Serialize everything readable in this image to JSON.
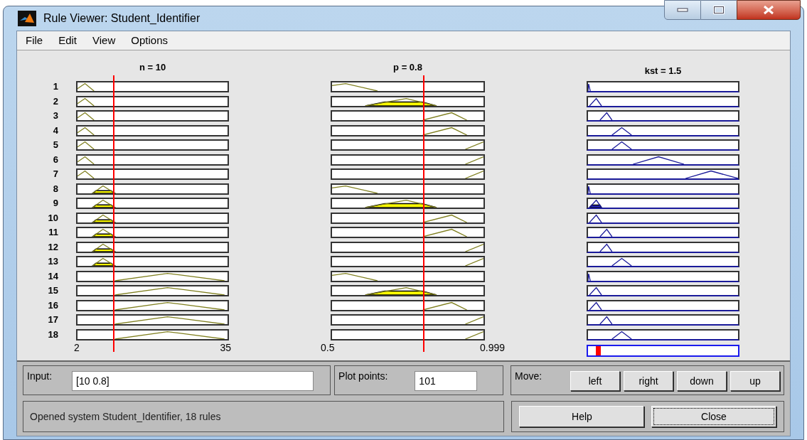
{
  "window": {
    "title": "Rule Viewer: Student_Identifier"
  },
  "menu": [
    "File",
    "Edit",
    "View",
    "Options"
  ],
  "inputs": [
    {
      "label": "n = 10",
      "tick_min": "2",
      "tick_max": "35",
      "level": 0.24
    },
    {
      "label": "p = 0.8",
      "tick_min": "0.5",
      "tick_max": "0.999",
      "level": 0.6
    }
  ],
  "output": {
    "label": "kst = 1.5",
    "level": 0.05
  },
  "rules": [
    {
      "number": "1",
      "cells": [
        {
          "kind": "small",
          "fired": false
        },
        {
          "kind": "low",
          "fired": false
        },
        {
          "kind": "zero",
          "fired": false
        }
      ]
    },
    {
      "number": "2",
      "cells": [
        {
          "kind": "small",
          "fired": false
        },
        {
          "kind": "mid",
          "fired": true
        },
        {
          "kind": "tiny",
          "fired": false
        }
      ]
    },
    {
      "number": "3",
      "cells": [
        {
          "kind": "small",
          "fired": false
        },
        {
          "kind": "high",
          "fired": false
        },
        {
          "kind": "small",
          "fired": false
        }
      ]
    },
    {
      "number": "4",
      "cells": [
        {
          "kind": "small",
          "fired": false
        },
        {
          "kind": "high",
          "fired": false
        },
        {
          "kind": "medium",
          "fired": false
        }
      ]
    },
    {
      "number": "5",
      "cells": [
        {
          "kind": "small",
          "fired": false
        },
        {
          "kind": "top",
          "fired": false
        },
        {
          "kind": "medium",
          "fired": false
        }
      ]
    },
    {
      "number": "6",
      "cells": [
        {
          "kind": "small",
          "fired": false
        },
        {
          "kind": "top",
          "fired": false
        },
        {
          "kind": "large",
          "fired": false
        }
      ]
    },
    {
      "number": "7",
      "cells": [
        {
          "kind": "small",
          "fired": false
        },
        {
          "kind": "top",
          "fired": false
        },
        {
          "kind": "huge",
          "fired": false
        }
      ]
    },
    {
      "number": "8",
      "cells": [
        {
          "kind": "medium",
          "fired": true
        },
        {
          "kind": "low",
          "fired": false
        },
        {
          "kind": "zero",
          "fired": false
        }
      ]
    },
    {
      "number": "9",
      "cells": [
        {
          "kind": "medium",
          "fired": true
        },
        {
          "kind": "mid",
          "fired": true
        },
        {
          "kind": "tiny",
          "fired": true
        }
      ]
    },
    {
      "number": "10",
      "cells": [
        {
          "kind": "medium",
          "fired": true
        },
        {
          "kind": "high",
          "fired": false
        },
        {
          "kind": "tiny",
          "fired": false
        }
      ]
    },
    {
      "number": "11",
      "cells": [
        {
          "kind": "medium",
          "fired": true
        },
        {
          "kind": "high",
          "fired": false
        },
        {
          "kind": "small",
          "fired": false
        }
      ]
    },
    {
      "number": "12",
      "cells": [
        {
          "kind": "medium",
          "fired": true
        },
        {
          "kind": "top",
          "fired": false
        },
        {
          "kind": "small",
          "fired": false
        }
      ]
    },
    {
      "number": "13",
      "cells": [
        {
          "kind": "medium",
          "fired": true
        },
        {
          "kind": "top",
          "fired": false
        },
        {
          "kind": "medium",
          "fired": false
        }
      ]
    },
    {
      "number": "14",
      "cells": [
        {
          "kind": "large",
          "fired": false
        },
        {
          "kind": "low",
          "fired": false
        },
        {
          "kind": "zero",
          "fired": false
        }
      ]
    },
    {
      "number": "15",
      "cells": [
        {
          "kind": "large",
          "fired": false
        },
        {
          "kind": "mid",
          "fired": true
        },
        {
          "kind": "tiny",
          "fired": false
        }
      ]
    },
    {
      "number": "16",
      "cells": [
        {
          "kind": "large",
          "fired": false
        },
        {
          "kind": "high",
          "fired": false
        },
        {
          "kind": "tiny",
          "fired": false
        }
      ]
    },
    {
      "number": "17",
      "cells": [
        {
          "kind": "large",
          "fired": false
        },
        {
          "kind": "top",
          "fired": false
        },
        {
          "kind": "small",
          "fired": false
        }
      ]
    },
    {
      "number": "18",
      "cells": [
        {
          "kind": "large",
          "fired": false
        },
        {
          "kind": "top",
          "fired": false
        },
        {
          "kind": "medium",
          "fired": false
        }
      ]
    }
  ],
  "input_field": {
    "label": "Input:",
    "value": "[10 0.8]"
  },
  "plot_points": {
    "label": "Plot points:",
    "value": "101"
  },
  "move": {
    "label": "Move:",
    "buttons": [
      "left",
      "right",
      "down",
      "up"
    ]
  },
  "status": "Opened system Student_Identifier, 18 rules",
  "buttons": [
    {
      "label": "Help",
      "focused": false
    },
    {
      "label": "Close",
      "focused": true
    }
  ]
}
